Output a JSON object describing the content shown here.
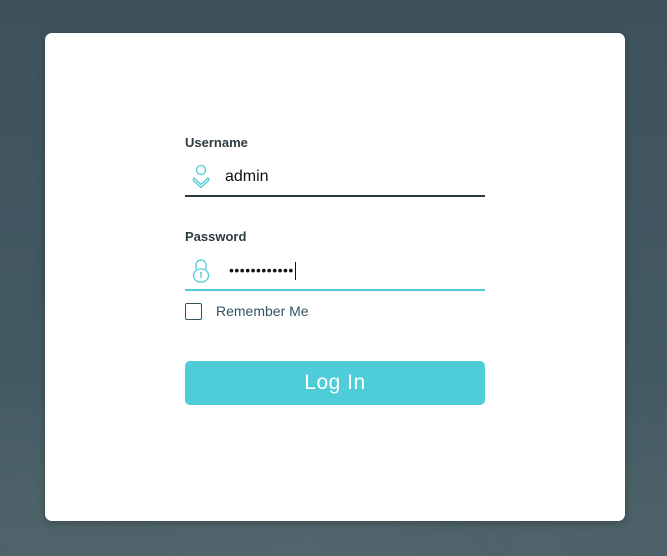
{
  "login_form": {
    "username": {
      "label": "Username",
      "value": "admin",
      "icon": "user-icon"
    },
    "password": {
      "label": "Password",
      "masked_value": "••••••••••••",
      "icon": "lock-icon"
    },
    "remember_me": {
      "label": "Remember Me",
      "checked": false
    },
    "login_button_label": "Log In"
  },
  "colors": {
    "accent": "#4ecdd8",
    "text_dark": "#2f3a40",
    "remember_text": "#2f5660",
    "background": "#3f525c",
    "card": "#ffffff"
  }
}
